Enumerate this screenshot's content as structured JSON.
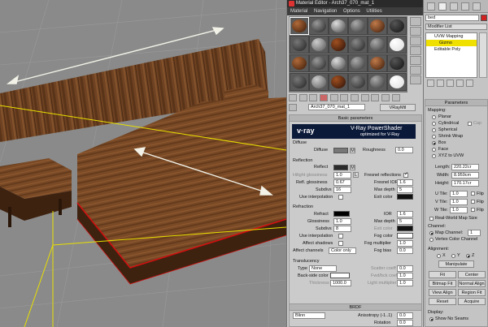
{
  "viewport": {
    "colors": {
      "wood_dark": "#4a2a14",
      "wood_mid": "#7a4a26",
      "selection": "#e8e000",
      "edge": "#d01010"
    }
  },
  "material_editor": {
    "title": "Material Editor - Arch37_070_mat_1",
    "menu": [
      "Material",
      "Navigation",
      "Options",
      "Utilities"
    ],
    "material_name": "Arch37_070_mat_1",
    "material_type": "VRayMtl",
    "basic_parameters": {
      "header": "Basic parameters",
      "logo": "v·ray",
      "banner_line1": "V-Ray PowerShader",
      "banner_line2": "optimized for V-Ray",
      "diffuse": {
        "group": "Diffuse",
        "diffuse_label": "Diffuse",
        "diffuse_map": "M",
        "roughness_label": "Roughness",
        "roughness_value": "0.0"
      },
      "reflection": {
        "group": "Reflection",
        "reflect_label": "Reflect",
        "reflect_map": "M",
        "hilight_label": "Hilight glossiness",
        "hilight_value": "1.0",
        "hilight_lock": "L",
        "fresnel_label": "Fresnel reflections",
        "refl_gloss_label": "Refl. glossiness",
        "refl_gloss_value": "0.67",
        "fresnel_ior_label": "Fresnel IOR",
        "fresnel_ior_value": "1.6",
        "subdivs_label": "Subdivs",
        "subdivs_value": "16",
        "max_depth_label": "Max depth",
        "max_depth_value": "5",
        "use_interp_label": "Use interpolation",
        "exit_color_label": "Exit color"
      },
      "refraction": {
        "group": "Refraction",
        "refract_label": "Refract",
        "ior_label": "IOR",
        "ior_value": "1.6",
        "glossiness_label": "Glossiness",
        "glossiness_value": "1.0",
        "max_depth_label": "Max depth",
        "max_depth_value": "5",
        "subdivs_label": "Subdivs",
        "subdivs_value": "8",
        "exit_color_label": "Exit color",
        "use_interp_label": "Use interpolation",
        "fog_color_label": "Fog color",
        "affect_shadows_label": "Affect shadows",
        "fog_mult_label": "Fog multiplier",
        "fog_mult_value": "1.0",
        "affect_channels_label": "Affect channels",
        "affect_channels_value": "Color only",
        "fog_bias_label": "Fog bias",
        "fog_bias_value": "0.0"
      },
      "translucency": {
        "group": "Translucency",
        "type_label": "Type",
        "type_value": "None",
        "scatter_label": "Scatter coeff",
        "scatter_value": "0.0",
        "backside_label": "Back-side color",
        "fwd_bck_label": "Fwd/bck coeff",
        "fwd_bck_value": "1.0",
        "thickness_label": "Thickness",
        "thickness_value": "1000.0",
        "light_mult_label": "Light multiplier",
        "light_mult_value": "1.0"
      }
    },
    "brdf": {
      "header": "BRDF",
      "type_value": "Blinn",
      "anisotropy_label": "Anisotropy (-1..1)",
      "anisotropy_value": "0.0",
      "rotation_label": "Rotation",
      "rotation_value": "0.0"
    }
  },
  "modifier_panel": {
    "object_name": "bed",
    "modifier_list_label": "Modifier List",
    "stack": [
      "UVW Mapping",
      "Gizmo",
      "Editable Poly"
    ],
    "parameters_header": "Parameters",
    "mapping_label": "Mapping:",
    "mapping_options": [
      "Planar",
      "Cylindrical",
      "Spherical",
      "Shrink Wrap",
      "Box",
      "Face",
      "XYZ to UVW"
    ],
    "cap_label": "Cap",
    "length_label": "Length:",
    "length_value": "220.22cr",
    "width_label": "Width:",
    "width_value": "8.959cm",
    "height_label": "Height:",
    "height_value": "170.17cr",
    "u_tile_label": "U Tile:",
    "u_tile_value": "1.0",
    "v_tile_label": "V Tile:",
    "v_tile_value": "1.0",
    "w_tile_label": "W Tile:",
    "w_tile_value": "1.0",
    "flip_label": "Flip",
    "real_world_label": "Real-World Map Size",
    "channel_label": "Channel:",
    "map_channel_label": "Map Channel:",
    "map_channel_value": "1",
    "vertex_color_label": "Vertex Color Channel",
    "alignment_label": "Alignment:",
    "axes": [
      "X",
      "Y",
      "Z"
    ],
    "manipulate_label": "Manipulate",
    "buttons": [
      "Fit",
      "Center",
      "Bitmap Fit",
      "Normal Align",
      "View Align",
      "Region Fit",
      "Reset",
      "Acquire"
    ],
    "display_label": "Display:",
    "show_no_seams_label": "Show No Seams"
  }
}
